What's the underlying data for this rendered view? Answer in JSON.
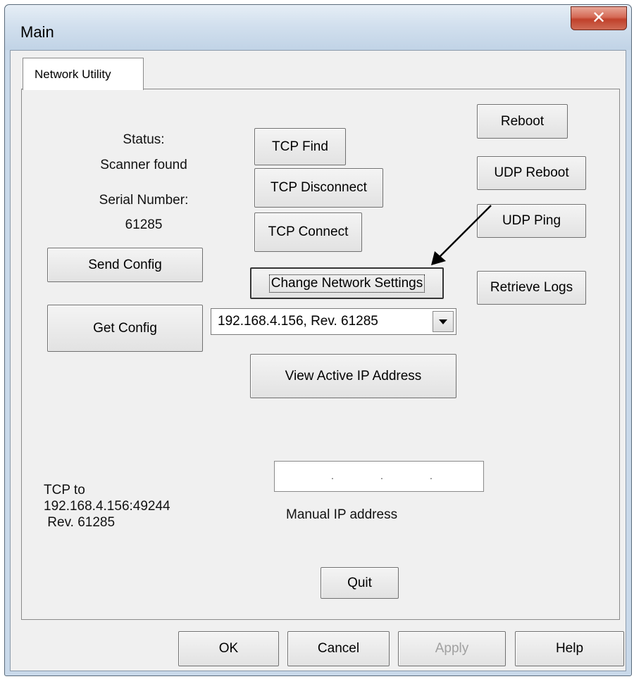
{
  "window": {
    "title": "Main",
    "close_glyph": "✕"
  },
  "tabs": [
    {
      "label": "Network Utility"
    }
  ],
  "status": {
    "status_label": "Status:",
    "status_value": "Scanner found",
    "serial_label": "Serial Number:",
    "serial_value": "61285"
  },
  "buttons": {
    "tcp_find": "TCP Find",
    "tcp_disconnect": "TCP Disconnect",
    "tcp_connect": "TCP Connect",
    "reboot": "Reboot",
    "udp_reboot": "UDP Reboot",
    "udp_ping": "UDP Ping",
    "send_config": "Send Config",
    "get_config": "Get Config",
    "change_network_settings": "Change Network Settings",
    "retrieve_logs": "Retrieve Logs",
    "view_active_ip": "View Active IP Address",
    "quit": "Quit"
  },
  "device_select": {
    "value": "192.168.4.156, Rev. 61285"
  },
  "connection_info": {
    "line1": "TCP to",
    "line2": "192.168.4.156:49244",
    "line3": " Rev. 61285"
  },
  "manual_ip": {
    "label": "Manual IP address",
    "value": ". . ."
  },
  "footer": {
    "ok": "OK",
    "cancel": "Cancel",
    "apply": "Apply",
    "help": "Help"
  },
  "colors": {
    "titlebar": "#d2e0ee",
    "close": "#c0412b",
    "dialog_bg": "#f0f0f0"
  }
}
